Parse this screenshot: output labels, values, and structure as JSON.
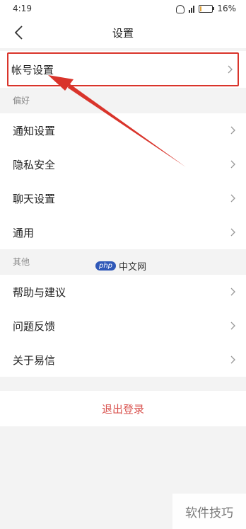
{
  "status": {
    "time": "4:19",
    "battery": "16%",
    "battery_level": 0.16
  },
  "header": {
    "title": "设置"
  },
  "account": {
    "label": "帐号设置"
  },
  "sections": [
    {
      "label": "偏好",
      "items": [
        "通知设置",
        "隐私安全",
        "聊天设置",
        "通用"
      ]
    },
    {
      "label": "其他",
      "items": [
        "帮助与建议",
        "问题反馈",
        "关于易信"
      ]
    }
  ],
  "logout": {
    "label": "退出登录"
  },
  "watermarks": {
    "badge": "php",
    "center": "中文网",
    "corner": "软件技巧"
  },
  "colors": {
    "accent": "#d9342b",
    "logout_text": "#d9534f",
    "background": "#f3f3f3"
  }
}
